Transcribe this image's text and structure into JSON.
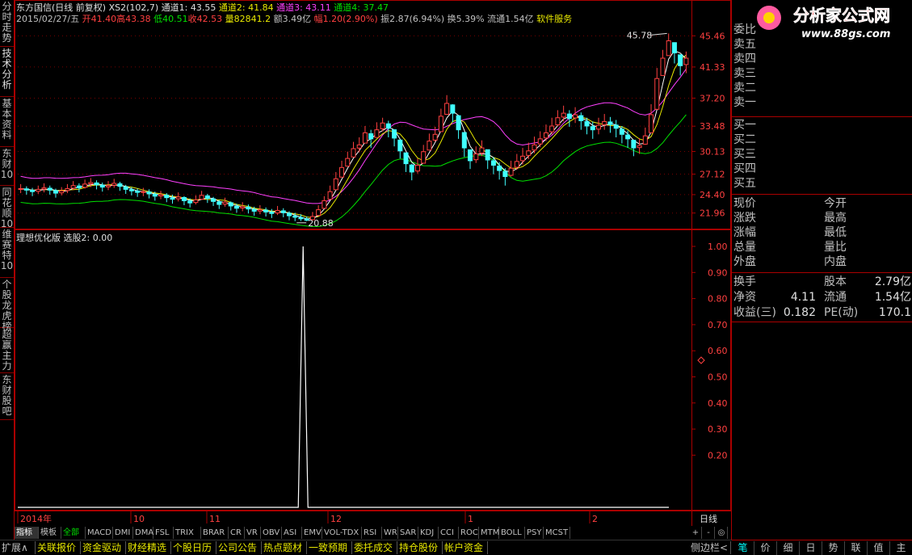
{
  "header": {
    "line1_stock": "东方国信(日线 前复权)",
    "line1_formula": "XS2(102,7)",
    "line1_ch1": "通道1: 43.55",
    "line1_ch2": "通道2: 41.84",
    "line1_ch3": "通道3: 43.11",
    "line1_ch4": "通道4: 37.47",
    "line2_date": "2015/02/27/五",
    "line2_open": "开41.40",
    "line2_high": "高43.38",
    "line2_low": "低40.51",
    "line2_close": "收42.53",
    "line2_vol": "量82841.2",
    "line2_amt": "额3.49亿",
    "line2_chg": "幅1.20(2.90%)",
    "line2_amp": "振2.87(6.94%)",
    "line2_turn": "换5.39%",
    "line2_float": "流通1.54亿",
    "line2_ind": "软件服务"
  },
  "left_tabs": [
    "分时走势",
    "技术分析",
    "基本资料",
    "东财10",
    "同花顺10",
    "维赛特10",
    "个股龙虎榜",
    "超赢主力",
    "东财股吧"
  ],
  "price_axis": [
    "45.46",
    "41.33",
    "37.20",
    "33.48",
    "30.13",
    "27.12",
    "24.40",
    "21.96"
  ],
  "indicator": {
    "title": "理想优化版",
    "select": "选股2: 0.00",
    "axis": [
      "1.00",
      "0.90",
      "0.80",
      "0.70",
      "0.60",
      "0.50",
      "0.40",
      "0.30",
      "0.20"
    ]
  },
  "annotations": {
    "high": "45.78",
    "low": "20.88"
  },
  "date_axis": [
    {
      "label": "2014年",
      "pos": 0
    },
    {
      "label": "10",
      "pos": 1
    },
    {
      "label": "11",
      "pos": 2
    },
    {
      "label": "12",
      "pos": 3
    },
    {
      "label": "1",
      "pos": 4
    },
    {
      "label": "2",
      "pos": 5
    }
  ],
  "period_label": "日线",
  "zoom_buttons": [
    "+",
    "-",
    "◎"
  ],
  "bottom_tabs1": [
    "指标",
    "模板",
    "全部",
    "MACD",
    "DMI",
    "DMA",
    "FSL",
    "TRIX",
    "BRAR",
    "CR",
    "VR",
    "OBV",
    "ASI",
    "EMV",
    "VOL-TDX",
    "RSI",
    "WR",
    "SAR",
    "KDJ",
    "CCI",
    "ROC",
    "MTM",
    "BOLL",
    "PSY",
    "MCST"
  ],
  "bottom_tabs2": [
    "扩展∧",
    "关联报价",
    "资金驱动",
    "财经精选",
    "个股日历",
    "公司公告",
    "热点题材",
    "一致预期",
    "委托成交",
    "持仓股份",
    "帐户资金"
  ],
  "side_toggle": "侧边栏<",
  "right_bottom_tabs": [
    "笔",
    "价",
    "细",
    "日",
    "势",
    "联",
    "值",
    "主"
  ],
  "order_book": {
    "header": "委比",
    "sell": [
      "卖五",
      "卖四",
      "卖三",
      "卖二",
      "卖一"
    ],
    "buy": [
      "买一",
      "买二",
      "买三",
      "买四",
      "买五"
    ]
  },
  "quote": [
    {
      "l": "现价",
      "r": "今开"
    },
    {
      "l": "涨跌",
      "r": "最高"
    },
    {
      "l": "涨幅",
      "r": "最低"
    },
    {
      "l": "总量",
      "r": "量比"
    },
    {
      "l": "外盘",
      "r": "内盘"
    }
  ],
  "fundamentals": [
    {
      "l": "换手",
      "v1": "",
      "r": "股本",
      "v2": "2.79亿"
    },
    {
      "l": "净资",
      "v1": "4.11",
      "r": "流通",
      "v2": "1.54亿"
    },
    {
      "l": "收益(三)",
      "v1": "0.182",
      "r": "PE(动)",
      "v2": "170.1"
    }
  ],
  "logo": {
    "title": "分析家公式网",
    "url": "www.88gs.com"
  },
  "colors": {
    "up": "#ff4040",
    "down": "#40ffff",
    "ch1": "#ffffff",
    "ch2": "#e8e800",
    "ch3": "#ff40ff",
    "ch4": "#00e000",
    "border": "#aa0000"
  },
  "chart_data": {
    "type": "candlestick",
    "ylim": [
      20,
      47
    ],
    "close": [
      25.2,
      25.0,
      24.8,
      25.1,
      25.3,
      25.0,
      24.6,
      24.9,
      25.2,
      25.6,
      25.3,
      25.8,
      26.0,
      25.7,
      25.4,
      25.6,
      25.9,
      25.5,
      25.1,
      24.9,
      24.7,
      24.8,
      24.5,
      24.2,
      24.4,
      24.0,
      23.8,
      24.1,
      23.6,
      23.3,
      23.7,
      24.3,
      23.9,
      23.5,
      23.1,
      23.4,
      22.9,
      22.6,
      22.8,
      22.5,
      22.2,
      22.4,
      22.1,
      21.9,
      22.3,
      22.0,
      21.6,
      21.4,
      21.2,
      21.0,
      21.5,
      22.4,
      23.6,
      24.8,
      26.5,
      28.0,
      29.2,
      30.5,
      31.0,
      32.6,
      31.8,
      33.0,
      33.9,
      33.2,
      31.9,
      30.2,
      28.5,
      27.4,
      28.3,
      30.1,
      31.5,
      32.4,
      34.8,
      36.5,
      35.2,
      33.0,
      30.6,
      28.9,
      29.8,
      30.6,
      29.0,
      28.3,
      27.6,
      26.8,
      27.9,
      28.8,
      29.5,
      30.2,
      31.0,
      31.8,
      32.6,
      33.5,
      34.6,
      35.2,
      34.5,
      35.0,
      34.2,
      33.5,
      33.0,
      33.6,
      34.1,
      33.7,
      33.2,
      32.4,
      31.8,
      30.6,
      30.9,
      32.2,
      35.0,
      39.8,
      42.5,
      44.8,
      43.2,
      41.5,
      42.5
    ],
    "high": [
      25.8,
      25.5,
      25.3,
      25.6,
      25.9,
      25.6,
      25.2,
      25.4,
      25.8,
      26.2,
      25.9,
      26.4,
      26.6,
      26.3,
      26.0,
      26.2,
      26.5,
      26.1,
      25.7,
      25.4,
      25.2,
      25.3,
      25.1,
      24.8,
      24.9,
      24.6,
      24.4,
      24.7,
      24.2,
      23.9,
      24.3,
      24.9,
      24.5,
      24.1,
      23.7,
      24.0,
      23.5,
      23.2,
      23.4,
      23.1,
      22.8,
      23.0,
      22.7,
      22.5,
      22.9,
      22.6,
      22.2,
      22.0,
      21.8,
      21.5,
      22.1,
      23.0,
      24.2,
      25.6,
      27.4,
      28.9,
      30.1,
      31.4,
      32.0,
      33.5,
      33.0,
      34.0,
      34.6,
      34.2,
      33.0,
      31.2,
      29.6,
      28.5,
      29.2,
      31.0,
      32.5,
      33.4,
      35.8,
      37.6,
      36.4,
      34.2,
      31.8,
      30.0,
      30.8,
      31.6,
      30.2,
      29.4,
      28.7,
      27.9,
      28.9,
      29.8,
      30.6,
      31.3,
      32.1,
      32.8,
      33.7,
      34.6,
      35.6,
      36.2,
      35.6,
      36.0,
      35.3,
      34.6,
      34.1,
      34.6,
      35.1,
      34.7,
      34.3,
      33.5,
      32.9,
      31.7,
      31.9,
      33.3,
      36.4,
      41.2,
      43.6,
      45.78,
      44.6,
      43.0,
      43.38
    ],
    "low": [
      24.6,
      24.4,
      24.2,
      24.5,
      24.7,
      24.4,
      24.0,
      24.3,
      24.6,
      25.0,
      24.7,
      25.2,
      25.4,
      25.1,
      24.8,
      25.0,
      25.3,
      24.9,
      24.5,
      24.3,
      24.1,
      24.2,
      23.9,
      23.6,
      23.8,
      23.4,
      23.2,
      23.5,
      23.0,
      22.7,
      23.1,
      23.7,
      23.3,
      22.9,
      22.5,
      22.8,
      22.3,
      22.0,
      22.2,
      21.9,
      21.6,
      21.8,
      21.5,
      21.3,
      21.7,
      21.4,
      21.0,
      20.88,
      20.9,
      20.88,
      21.0,
      21.8,
      22.8,
      23.9,
      25.5,
      27.0,
      28.2,
      29.5,
      30.0,
      31.5,
      30.6,
      32.0,
      32.8,
      32.0,
      30.8,
      29.2,
      27.4,
      26.3,
      27.2,
      29.0,
      30.4,
      31.4,
      33.6,
      35.4,
      34.0,
      31.8,
      29.4,
      27.8,
      28.6,
      29.5,
      27.8,
      27.1,
      26.4,
      25.6,
      26.8,
      27.7,
      28.4,
      29.1,
      29.9,
      30.7,
      31.5,
      32.4,
      33.5,
      34.1,
      33.4,
      33.9,
      33.0,
      32.4,
      31.8,
      32.4,
      33.0,
      32.6,
      32.0,
      31.2,
      30.6,
      29.5,
      29.8,
      31.0,
      33.6,
      38.0,
      41.0,
      43.0,
      41.8,
      40.2,
      40.51
    ]
  }
}
